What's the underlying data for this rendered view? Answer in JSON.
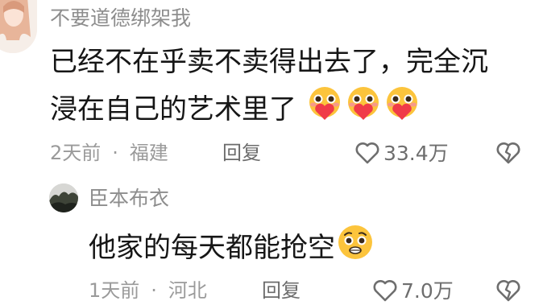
{
  "comments": [
    {
      "username": "不要道德绑架我",
      "text_line1": "已经不在乎卖不卖得出去了，完全沉",
      "text_line2": "浸在自己的艺术里了",
      "emojis": [
        "heart-hug-emoji",
        "heart-hug-emoji",
        "heart-hug-emoji"
      ],
      "time": "2天前",
      "location": "福建",
      "reply_label": "回复",
      "like_count": "33.4万",
      "avatar_icon": "anime-girl-avatar"
    },
    {
      "username": "臣本布衣",
      "text": "他家的每天都能抢空",
      "emojis": [
        "pleading-face-emoji"
      ],
      "time": "1天前",
      "location": "河北",
      "reply_label": "回复",
      "like_count": "7.0万",
      "avatar_icon": "landscape-photo-avatar"
    }
  ],
  "separator": "·",
  "colors": {
    "text": "#161616",
    "muted": "#9a9a9a",
    "emoji_face": "#fcc43c",
    "emoji_heart": "#f03b48"
  }
}
